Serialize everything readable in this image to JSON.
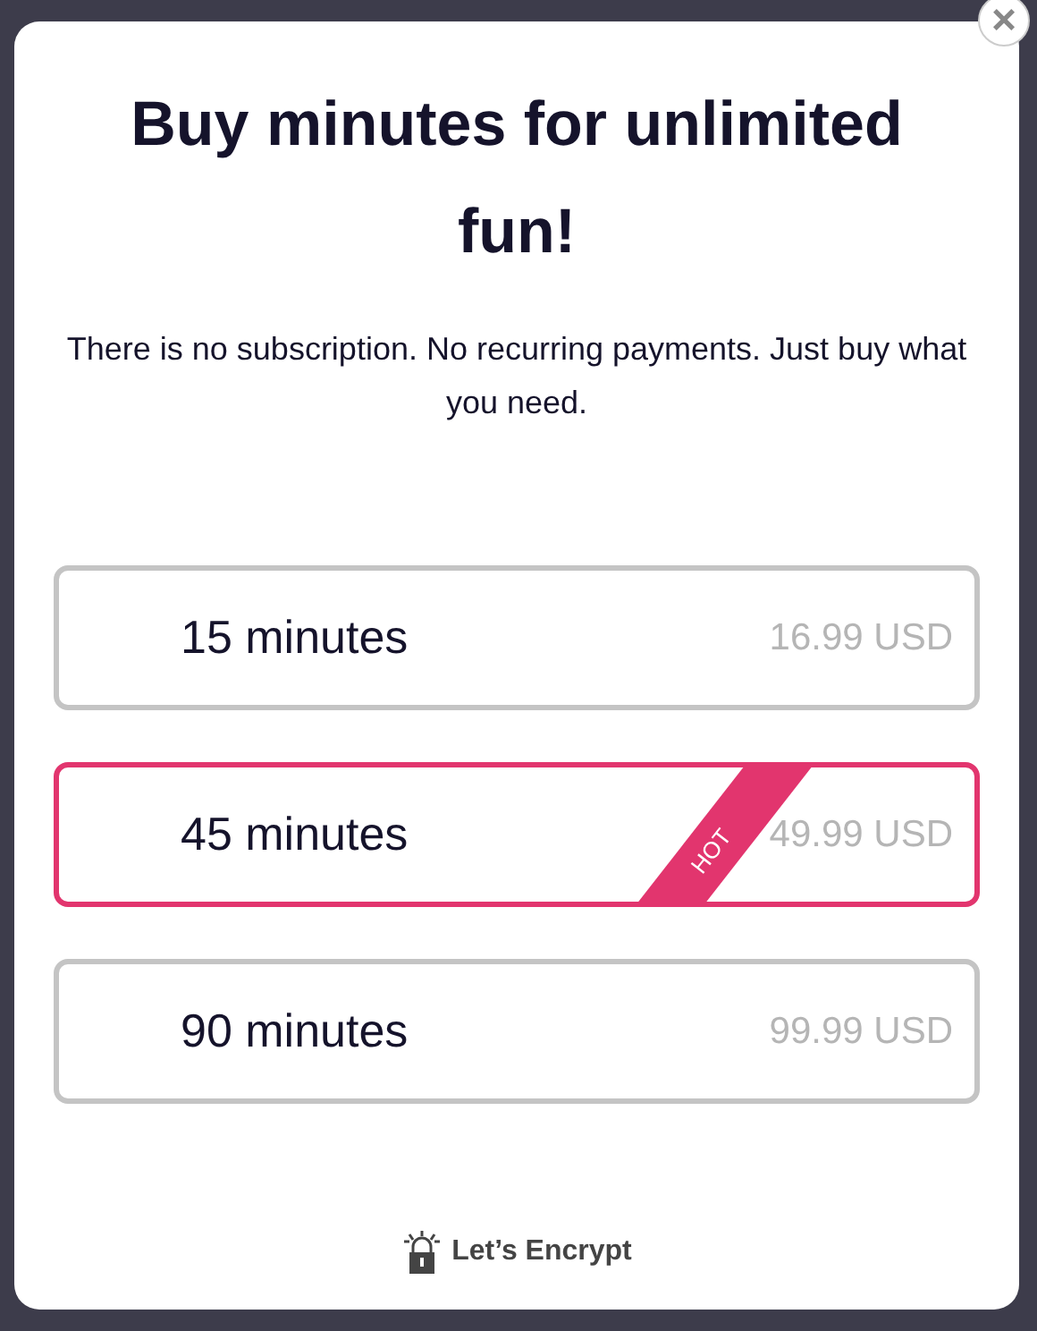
{
  "title": "Buy minutes for unlimited fun!",
  "subtitle": "There is no subscription. No recurring payments. Just buy what you need.",
  "close": "×",
  "options": [
    {
      "label": "15 minutes",
      "price": "16.99 USD",
      "selected": false
    },
    {
      "label": "45 minutes",
      "price": "49.99 USD",
      "selected": true,
      "badge": "HOT"
    },
    {
      "label": "90 minutes",
      "price": "99.99 USD",
      "selected": false
    }
  ],
  "footer": "Let’s Encrypt"
}
